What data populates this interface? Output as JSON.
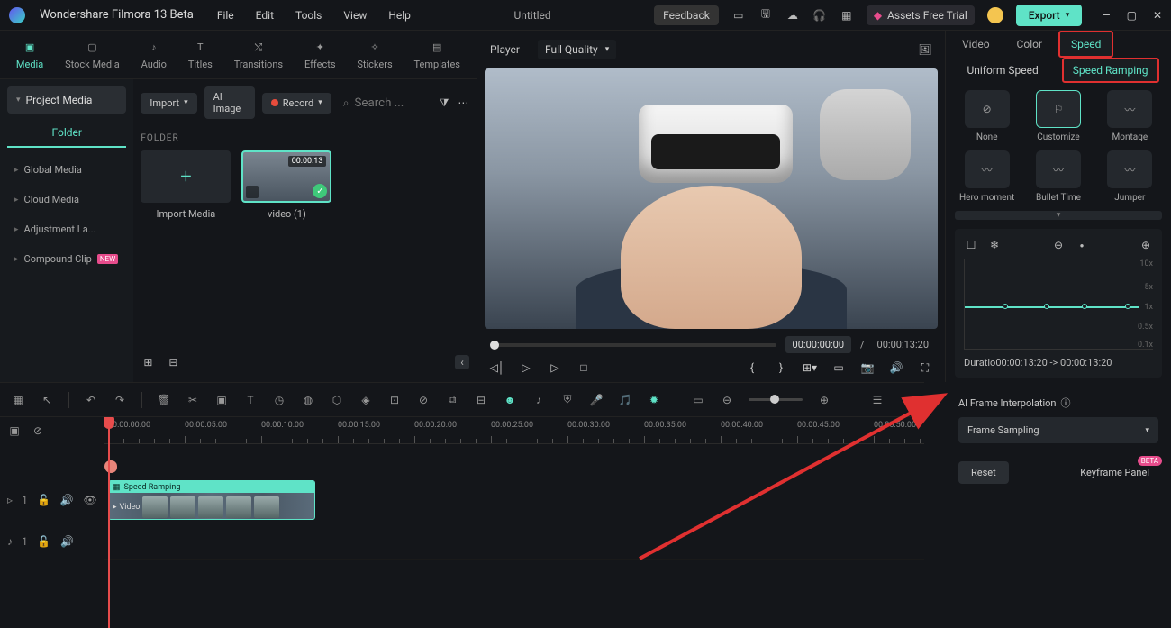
{
  "app": {
    "title": "Wondershare Filmora 13 Beta",
    "document": "Untitled"
  },
  "menubar": {
    "file": "File",
    "edit": "Edit",
    "tools": "Tools",
    "view": "View",
    "help": "Help"
  },
  "titleRight": {
    "feedback": "Feedback",
    "assets": "Assets Free Trial",
    "export": "Export"
  },
  "mediaTabs": {
    "media": "Media",
    "stockMedia": "Stock Media",
    "audio": "Audio",
    "titles": "Titles",
    "transitions": "Transitions",
    "effects": "Effects",
    "stickers": "Stickers",
    "templates": "Templates"
  },
  "mediaSidebar": {
    "projectMedia": "Project Media",
    "folder": "Folder",
    "globalMedia": "Global Media",
    "cloudMedia": "Cloud Media",
    "adjustment": "Adjustment La...",
    "compound": "Compound Clip"
  },
  "mediaToolbar": {
    "import": "Import",
    "aiImage": "AI Image",
    "record": "Record",
    "searchPlaceholder": "Search ..."
  },
  "mediaContent": {
    "folderLabel": "FOLDER",
    "importMedia": "Import Media",
    "video1": "video (1)",
    "video1Duration": "00:00:13"
  },
  "preview": {
    "player": "Player",
    "quality": "Full Quality",
    "currentTime": "00:00:00:00",
    "separator": "/",
    "totalTime": "00:00:13:20"
  },
  "rightTabs": {
    "video": "Video",
    "color": "Color",
    "speed": "Speed"
  },
  "speedSubTabs": {
    "uniform": "Uniform Speed",
    "ramping": "Speed Ramping"
  },
  "presets": {
    "none": "None",
    "customize": "Customize",
    "montage": "Montage",
    "hero": "Hero moment",
    "bullet": "Bullet Time",
    "jumper": "Jumper"
  },
  "rampGraph": {
    "y10": "10x",
    "y5": "5x",
    "y1": "1x",
    "y05": "0.5x",
    "y01": "0.1x",
    "duration": "Duratio00:00:13:20 -> 00:00:13:20"
  },
  "ai": {
    "label": "AI Frame Interpolation",
    "option": "Frame Sampling"
  },
  "rightBottom": {
    "reset": "Reset",
    "keyframe": "Keyframe Panel",
    "beta": "BETA"
  },
  "timeline": {
    "marks": [
      "00:00:00:00",
      "00:00:05:00",
      "00:00:10:00",
      "00:00:15:00",
      "00:00:20:00",
      "00:00:25:00",
      "00:00:30:00",
      "00:00:35:00",
      "00:00:40:00",
      "00:00:45:00",
      "00:00:50:00"
    ],
    "clipTitle": "Speed Ramping",
    "clipLabel": "Video"
  },
  "tracks": {
    "v1": "1",
    "a1": "1"
  }
}
